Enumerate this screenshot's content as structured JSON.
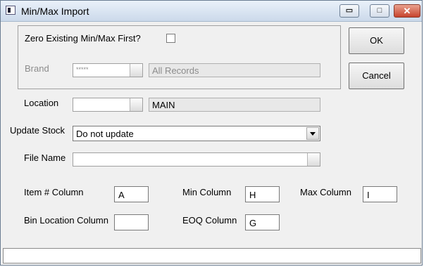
{
  "window": {
    "title": "Min/Max Import",
    "minimize_glyph": "▭",
    "maximize_glyph": "□",
    "close_glyph": "✕"
  },
  "group": {
    "zero_label": "Zero Existing Min/Max First?",
    "zero_checked": false,
    "brand_label": "Brand",
    "brand_value": "*****",
    "brand_desc": "All Records"
  },
  "location": {
    "label": "Location",
    "value": "",
    "desc": "MAIN"
  },
  "update_stock": {
    "label": "Update Stock",
    "value": "Do not update"
  },
  "file_name": {
    "label": "File Name",
    "value": ""
  },
  "columns": {
    "item_label": "Item # Column",
    "item_value": "A",
    "min_label": "Min Column",
    "min_value": "H",
    "max_label": "Max Column",
    "max_value": "I",
    "bin_label": "Bin Location Column",
    "bin_value": "",
    "eoq_label": "EOQ Column",
    "eoq_value": "G"
  },
  "buttons": {
    "ok": "OK",
    "cancel": "Cancel"
  },
  "status": {
    "text": ""
  }
}
